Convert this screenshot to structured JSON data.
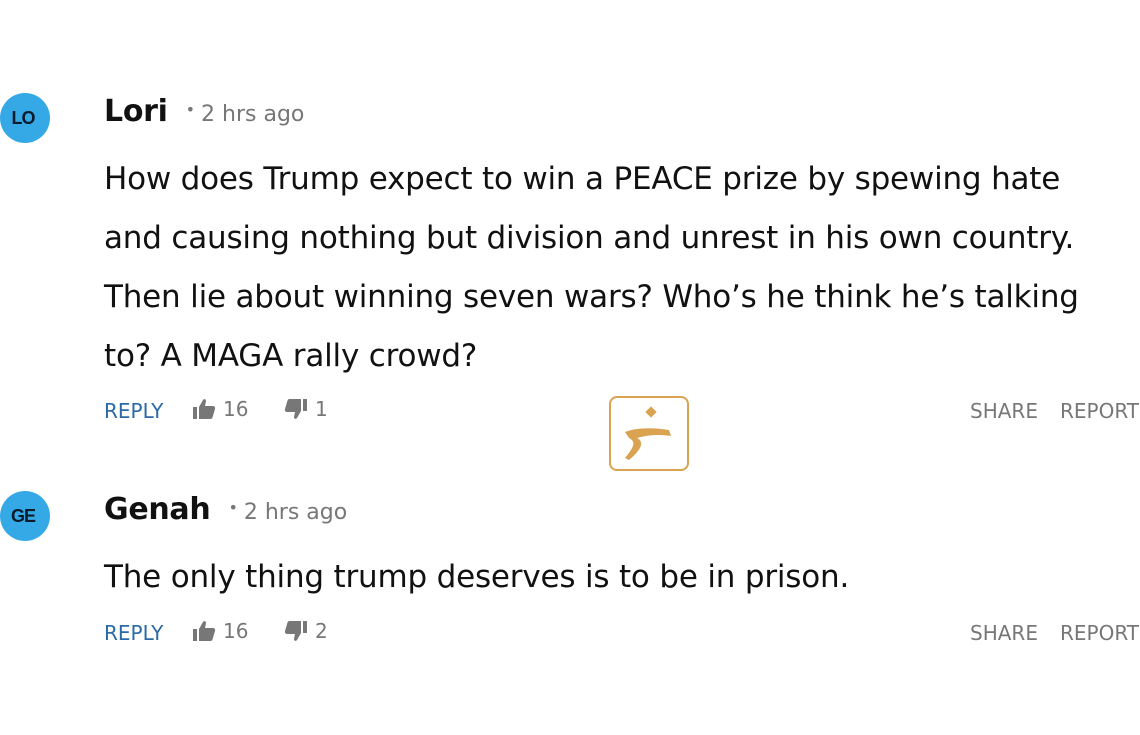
{
  "comments": [
    {
      "avatar_initials": "LO",
      "author": "Lori",
      "separator": "•",
      "time": "2 hrs ago",
      "text": "How does Trump expect to win a PEACE prize by spewing hate and causing nothing but division and unrest in his own country. Then lie about winning seven wars? Who’s he think he’s talking to? A MAGA rally crowd?",
      "reply_label": "REPLY",
      "likes": "16",
      "dislikes": "1",
      "share_label": "SHARE",
      "report_label": "REPORT"
    },
    {
      "avatar_initials": "GE",
      "author": "Genah",
      "separator": "•",
      "time": "2 hrs ago",
      "text": "The only thing trump deserves is to be in prison.",
      "reply_label": "REPLY",
      "likes": "16",
      "dislikes": "2",
      "share_label": "SHARE",
      "report_label": "REPORT"
    }
  ],
  "icons": {
    "like": "thumbs-up-icon",
    "dislike": "thumbs-down-icon",
    "watermark": "logo-watermark"
  },
  "colors": {
    "avatar": "#35a9e6",
    "reply": "#2b6aa6",
    "muted": "#777777",
    "watermark": "#d9a352"
  }
}
